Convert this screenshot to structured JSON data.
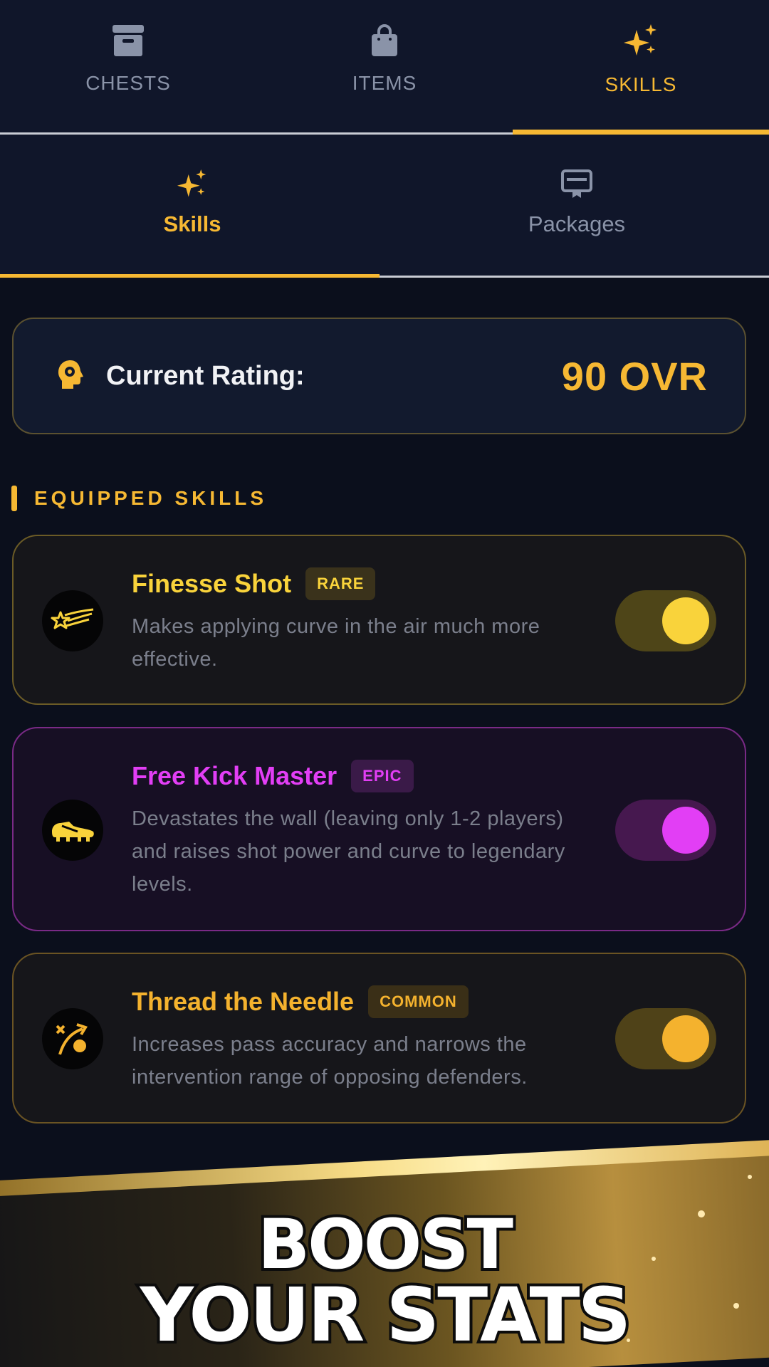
{
  "top_tabs": [
    {
      "label": "CHESTS",
      "icon": "archive-box-icon",
      "active": false
    },
    {
      "label": "ITEMS",
      "icon": "shopping-bag-icon",
      "active": false
    },
    {
      "label": "SKILLS",
      "icon": "sparkles-icon",
      "active": true
    }
  ],
  "sub_tabs": [
    {
      "label": "Skills",
      "icon": "sparkles-icon",
      "active": true
    },
    {
      "label": "Packages",
      "icon": "card-icon",
      "active": false
    }
  ],
  "rating": {
    "label": "Current Rating:",
    "value": "90 OVR",
    "icon": "head-gear-icon"
  },
  "section": {
    "title": "EQUIPPED SKILLS"
  },
  "skills": [
    {
      "name": "Finesse Shot",
      "rarity": "RARE",
      "description": "Makes applying curve in the air much more effective.",
      "icon": "shooting-star-icon",
      "enabled": true,
      "color": "#f9d33b"
    },
    {
      "name": "Free Kick Master",
      "rarity": "EPIC",
      "description": "Devastates the wall (leaving only 1-2 players) and raises shot power and curve to legendary levels.",
      "icon": "football-boot-icon",
      "enabled": true,
      "color": "#e23ef5"
    },
    {
      "name": "Thread the Needle",
      "rarity": "COMMON",
      "description": "Increases pass accuracy and narrows the intervention range of opposing defenders.",
      "icon": "pass-play-icon",
      "enabled": true,
      "color": "#f4b22e"
    }
  ],
  "promo": {
    "line1": "BOOST",
    "line2": "YOUR STATS"
  },
  "colors": {
    "accent": "#f6b833",
    "background": "#0b0f1c",
    "panel": "#10162a"
  }
}
